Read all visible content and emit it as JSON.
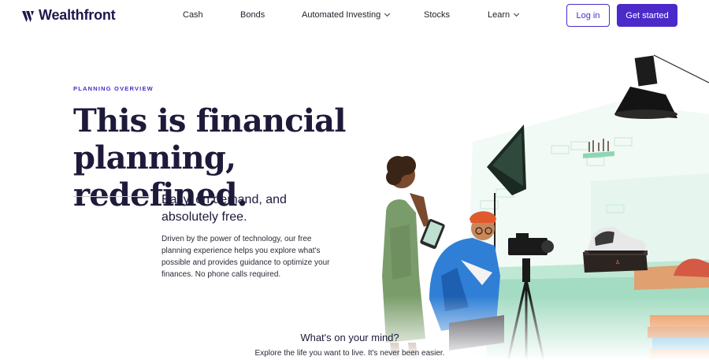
{
  "brand": {
    "name": "Wealthfront",
    "color": "#22154d",
    "accent": "#4a2bc9"
  },
  "nav": {
    "items": [
      {
        "label": "Cash",
        "has_dropdown": false
      },
      {
        "label": "Bonds",
        "has_dropdown": false
      },
      {
        "label": "Automated Investing",
        "has_dropdown": true
      },
      {
        "label": "Stocks",
        "has_dropdown": false
      },
      {
        "label": "Learn",
        "has_dropdown": true
      }
    ],
    "login_label": "Log in",
    "cta_label": "Get started"
  },
  "hero": {
    "eyebrow": "PLANNING OVERVIEW",
    "headline_line1": "This is financial planning,",
    "headline_line2": "redefined.",
    "subhead": "Easy, on demand, and absolutely free.",
    "body": "Driven by the power of technology, our free planning experience helps you explore what's possible and provides guidance to optimize your finances. No phone calls required."
  },
  "section": {
    "title": "What's on your mind?",
    "subtitle": "Explore the life you want to live. It's never been easier."
  }
}
